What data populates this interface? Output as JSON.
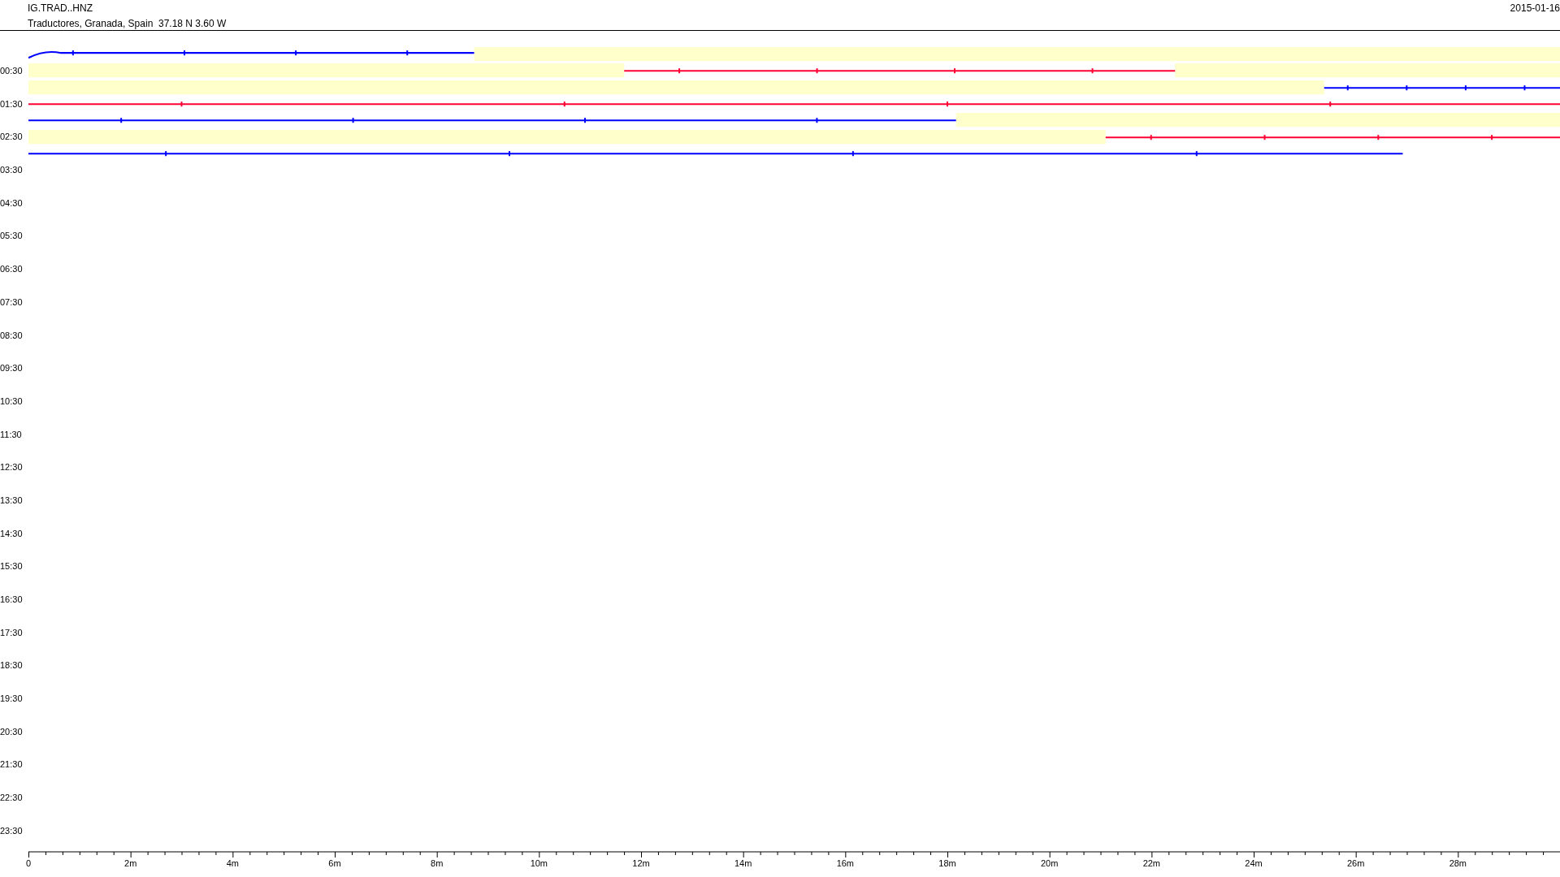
{
  "header": {
    "channel": "IG.TRAD..HNZ",
    "location": "Traductores, Granada, Spain  37.18 N 3.60 W",
    "date": "2015-01-16"
  },
  "hour_labels": [
    "00:30",
    "01:30",
    "02:30",
    "03:30",
    "04:30",
    "05:30",
    "06:30",
    "07:30",
    "08:30",
    "09:30",
    "10:30",
    "11:30",
    "12:30",
    "13:30",
    "14:30",
    "15:30",
    "16:30",
    "17:30",
    "18:30",
    "19:30",
    "20:30",
    "21:30",
    "22:30",
    "23:30"
  ],
  "traces": [
    {
      "color": "#0000ff"
    },
    {
      "color": "#ff0033"
    },
    {
      "color": "#0000ff"
    },
    {
      "color": "#ff0033"
    },
    {
      "color": "#0000ff"
    },
    {
      "color": "#ff0033"
    },
    {
      "color": "#0000ff"
    }
  ],
  "x_axis": {
    "labels": [
      "0",
      "2m",
      "4m",
      "6m",
      "8m",
      "10m",
      "12m",
      "14m",
      "16m",
      "18m",
      "20m",
      "22m",
      "24m",
      "26m",
      "28m"
    ]
  }
}
